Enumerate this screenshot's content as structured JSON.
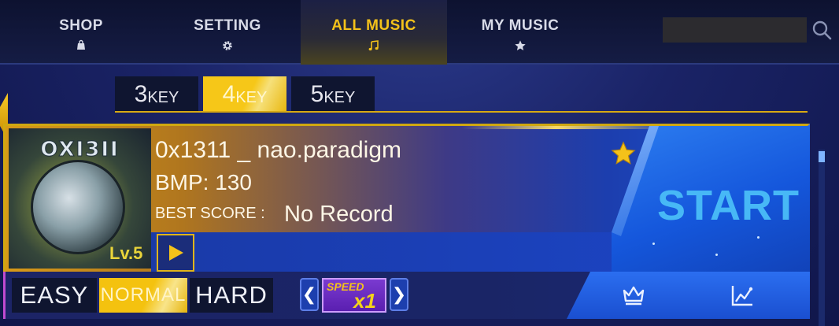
{
  "nav": {
    "items": [
      {
        "label": "SHOP",
        "icon": "shopping-bag-icon"
      },
      {
        "label": "SETTING",
        "icon": "gear-icon"
      },
      {
        "label": "ALL MUSIC",
        "icon": "music-note-icon",
        "active": true
      },
      {
        "label": "MY MUSIC",
        "icon": "star-icon"
      }
    ],
    "search": {
      "value": "",
      "icon": "search-icon"
    }
  },
  "key_tabs": [
    {
      "num": "3",
      "label": "KEY"
    },
    {
      "num": "4",
      "label": "KEY",
      "active": true
    },
    {
      "num": "5",
      "label": "KEY"
    }
  ],
  "song": {
    "title": "0x1311 _ nao.paradigm",
    "bpm_text": "BMP: 130",
    "best_score_label": "BEST SCORE :",
    "best_score_value": "No Record",
    "album": {
      "logo": "OXI3II",
      "level": "Lv.5"
    },
    "start_label": "START",
    "favorite": true
  },
  "difficulty": [
    {
      "label": "EASY"
    },
    {
      "label": "NORMAL",
      "active": true
    },
    {
      "label": "HARD"
    }
  ],
  "speed": {
    "label": "SPEED",
    "value": "x1"
  },
  "colors": {
    "accent": "#f4c21a",
    "primary_blue": "#1f55d8",
    "start_text": "#47b8f6"
  }
}
